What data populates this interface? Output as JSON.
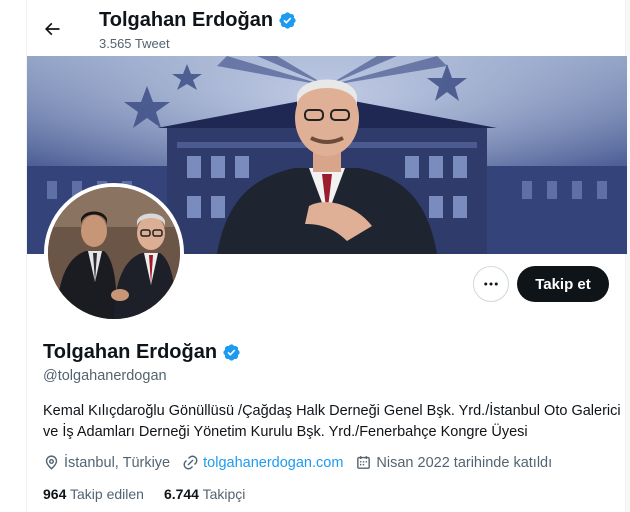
{
  "header": {
    "name": "Tolgahan Erdoğan",
    "tweet_count": "3.565 Tweet"
  },
  "actions": {
    "follow_label": "Takip et"
  },
  "profile": {
    "display_name": "Tolgahan Erdoğan",
    "handle": "@tolgahanerdogan",
    "bio": "Kemal Kılıçdaroğlu Gönüllüsü /Çağdaş Halk Derneği Genel Bşk. Yrd./İstanbul Oto Galerici ve İş Adamları Derneği Yönetim Kurulu Bşk. Yrd./Fenerbahçe Kongre Üyesi",
    "location": "İstanbul, Türkiye",
    "website": "tolgahanerdogan.com",
    "joined": "Nisan 2022 tarihinde katıldı"
  },
  "stats": {
    "following_count": "964",
    "following_label": "Takip edilen",
    "followers_count": "6.744",
    "followers_label": "Takipçi"
  },
  "icons": {
    "back": "arrow-left-icon",
    "verified": "verified-badge-icon",
    "more": "more-horizontal-icon",
    "location": "location-pin-icon",
    "link": "link-icon",
    "calendar": "calendar-icon"
  },
  "colors": {
    "accent": "#1d9bf0",
    "text": "#0f1419",
    "muted": "#536471",
    "button_dark": "#0f1419"
  }
}
